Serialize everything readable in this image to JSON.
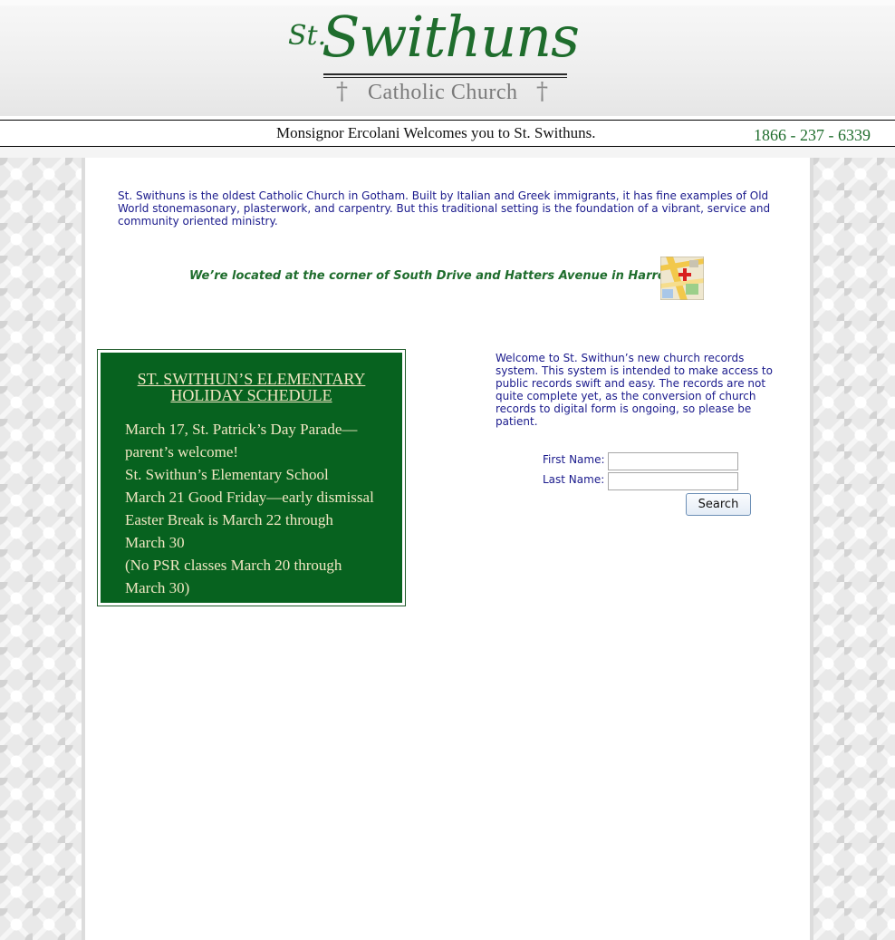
{
  "header": {
    "logo_st": "St.",
    "logo_name": "Swithuns",
    "logo_subtitle": "Catholic Church",
    "cross_glyph": "†"
  },
  "welcome_bar": {
    "welcome_text": "Monsignor Ercolani Welcomes you to St. Swithuns.",
    "phone": "1866 - 237 - 6339"
  },
  "intro": {
    "text": "St. Swithuns is the oldest Catholic Church in Gotham. Built by Italian and Greek immigrants, it has fine examples of Old World stonemasonary, plasterwork, and carpentry. But this traditional setting is the foundation of a vibrant, service and community oriented ministry."
  },
  "location": {
    "text": "We’re located at the corner of South Drive and Hatters Avenue in Harrow.",
    "icon": "map-icon"
  },
  "schedule": {
    "title_line1": "ST. SWITHUN’S ELEMENTARY",
    "title_line2": "HOLIDAY SCHEDULE",
    "lines": [
      "March 17, St. Patrick’s Day Parade—",
      "parent’s welcome!",
      "St. Swithun’s Elementary School",
      "March 21 Good Friday—early dismissal",
      "Easter Break is March 22 through",
      "March 30",
      "(No PSR classes March 20 through",
      "March 30)"
    ]
  },
  "records": {
    "text": "Welcome to St. Swithun’s new church records system. This system is intended to make access to public records swift and easy. The records are not quite complete yet, as the conversion of church records to digital form is ongoing, so please be patient.",
    "first_name_label": "First Name:",
    "last_name_label": "Last Name:",
    "first_name_value": "",
    "last_name_value": "",
    "search_label": "Search"
  },
  "colors": {
    "brand_green": "#1f6d2d",
    "text_blue": "#1a1a8c",
    "schedule_bg": "#07621f",
    "schedule_text": "#f0e6c2"
  }
}
